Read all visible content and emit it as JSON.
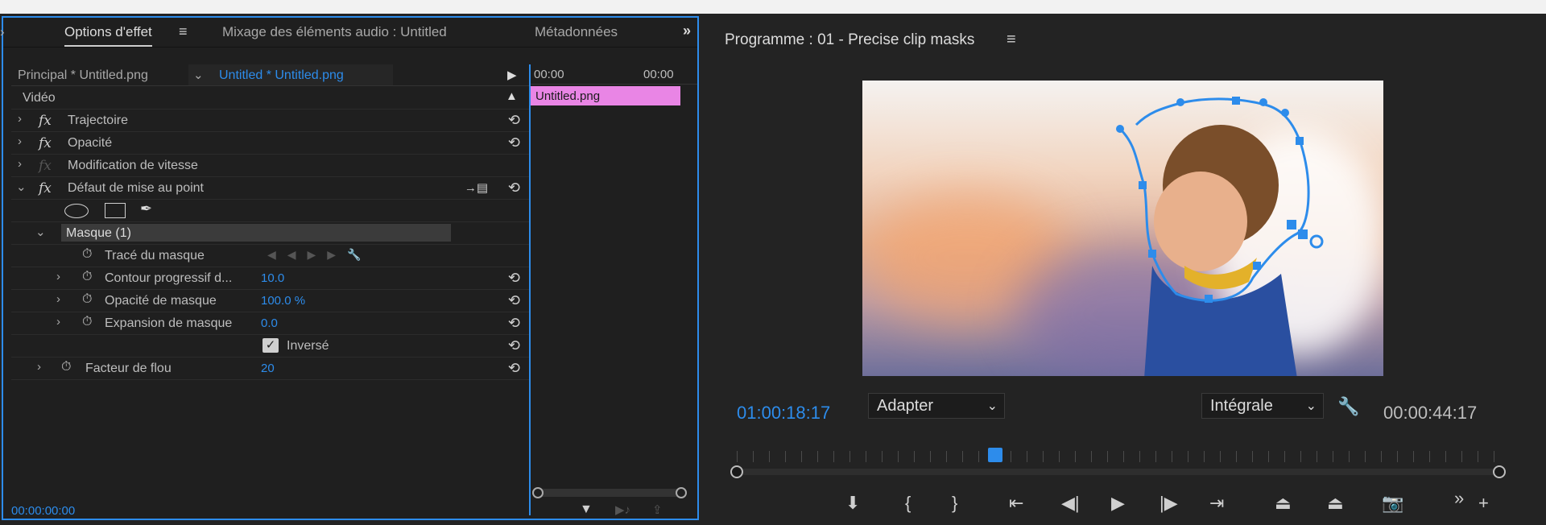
{
  "effect_panel": {
    "tabs": [
      {
        "label": "Options d'effet",
        "active": true
      },
      {
        "label": "Mixage des éléments audio : Untitled",
        "active": false
      },
      {
        "label": "Métadonnées",
        "active": false
      }
    ],
    "source_principal": "Principal * Untitled.png",
    "source_clip": "Untitled * Untitled.png",
    "section_label": "Vidéo",
    "rows": [
      {
        "label": "Trajectoire"
      },
      {
        "label": "Opacité"
      },
      {
        "label": "Modification de vitesse"
      },
      {
        "label": "Défaut de mise au point"
      }
    ],
    "mask_label": "Masque (1)",
    "mask_path_label": "Tracé du masque",
    "mask_props": [
      {
        "label": "Contour progressif d...",
        "value": "10.0"
      },
      {
        "label": "Opacité de masque",
        "value": "100.0 %"
      },
      {
        "label": "Expansion de masque",
        "value": "0.0"
      }
    ],
    "inverted_label": "Inversé",
    "inverted_checked": true,
    "blur_label": "Facteur de flou",
    "blur_value": "20",
    "timecode": "00:00:00:00",
    "timeline": {
      "ruler_start": "00:00",
      "ruler_end": "00:00",
      "clip_label": "Untitled.png",
      "clip_color": "#e985e5"
    }
  },
  "program_monitor": {
    "title": "Programme : 01 - Precise clip masks",
    "current_timecode": "01:00:18:17",
    "fit_dropdown": "Adapter",
    "quality_dropdown": "Intégrale",
    "duration": "00:00:44:17"
  },
  "colors": {
    "accent": "#2d8ceb",
    "panel_bg": "#1f1f1f",
    "background": "#232323"
  }
}
